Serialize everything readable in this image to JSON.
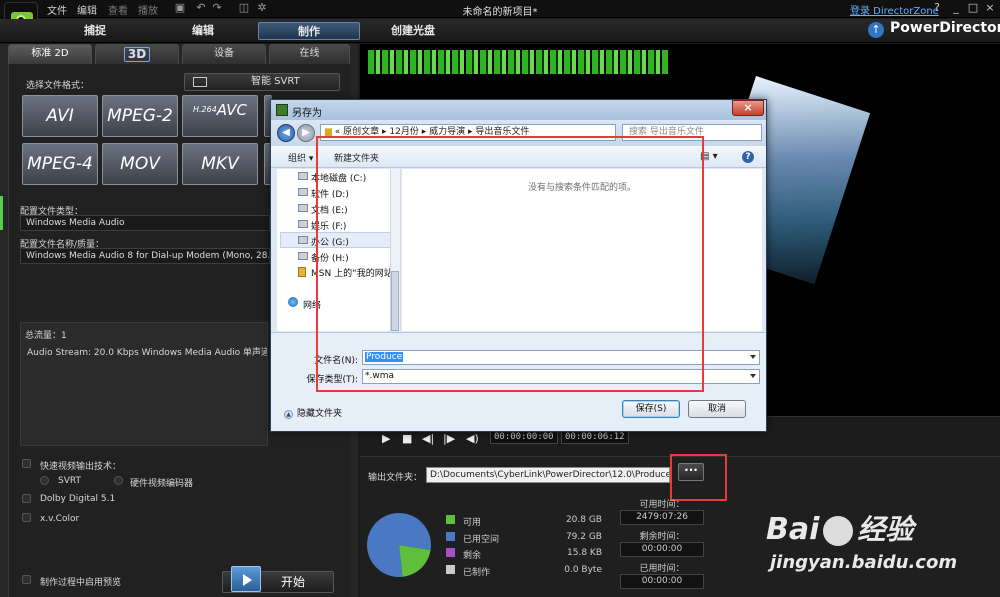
{
  "window": {
    "title": "未命名的新项目*",
    "login_link": "登录 DirectorZone",
    "help_button": "?",
    "minimize": "_",
    "maximize": "□",
    "close": "×"
  },
  "menu": [
    "文件",
    "编辑",
    "查看",
    "播放"
  ],
  "modes": [
    "捕捉",
    "编辑",
    "制作",
    "创建光盘"
  ],
  "brand": "PowerDirector",
  "left_tabs": [
    "标准 2D",
    "3D",
    "设备",
    "在线"
  ],
  "left": {
    "select_format_label": "选择文件格式：",
    "svrt_button": "智能 SVRT",
    "formats": [
      "AVI",
      "MPEG-2",
      "AVC",
      "MPEG-4",
      "MOV",
      "MKV"
    ],
    "h264_sup": "H.264",
    "profile_type_label": "配置文件类型：",
    "profile_type_value": "Windows Media Audio",
    "profile_name_label": "配置文件名称/质量：",
    "profile_name_value": "Windows Media Audio 8 for Dial-up Modem (Mono, 28.8 Kbps)",
    "info_title": "总流量：1",
    "info_text": "Audio Stream:  20.0 Kbps  Windows Media Audio  单声道  22",
    "fast_render_label": "快速视频输出技术：",
    "svrt_option": "SVRT",
    "hw_encoder_option": "硬件视频编码器",
    "dolby_label": "Dolby Digital 5.1",
    "xvcolor_label": "x.v.Color",
    "preview_during_label": "制作过程中启用预览",
    "start_button": "开始"
  },
  "player": {
    "time_current": "00:00:00:00",
    "time_total": "00:00:06:12"
  },
  "output": {
    "label": "输出文件夹：",
    "path": "D:\\Documents\\CyberLink\\PowerDirector\\12.0\\Produce.wma",
    "browse_button": "···",
    "legend": [
      {
        "label": "可用",
        "value": "20.8  GB",
        "color": "#5fbf3c"
      },
      {
        "label": "已用空间",
        "value": "79.2  GB",
        "color": "#4a78c2"
      },
      {
        "label": "剩余",
        "value": "15.8  KB",
        "color": "#a64fc4"
      },
      {
        "label": "已制作",
        "value": "0.0  Byte",
        "color": "#c9c9c9"
      }
    ],
    "available_time_label": "可用时间：",
    "available_time": "2479:07:26",
    "remaining_time_label": "剩余时间：",
    "remaining_time": "00:00:00",
    "used_time_label": "已用时间：",
    "used_time": "00:00:00"
  },
  "disk_chart": {
    "type": "pie",
    "slices": [
      {
        "name": "可用",
        "value": 20.8,
        "color": "#5fbf3c"
      },
      {
        "name": "已用空间",
        "value": 79.2,
        "color": "#4a78c2"
      }
    ]
  },
  "dialog": {
    "title": "另存为",
    "close": "×",
    "breadcrumb": "«  原创文章  ▸  12月份  ▸  威力导演  ▸  导出音乐文件",
    "search_placeholder": "搜索 导出音乐文件",
    "organize": "组织 ▾",
    "new_folder": "新建文件夹",
    "help_icon": "?",
    "tree": [
      "本地磁盘 (C:)",
      "软件 (D:)",
      "文档 (E:)",
      "娱乐 (F:)",
      "办公 (G:)",
      "备份 (H:)",
      "MSN 上的“我的网站”"
    ],
    "network": "网络",
    "empty_message": "没有与搜索条件匹配的项。",
    "filename_label": "文件名(N):",
    "filename_value": "Produce",
    "filetype_label": "保存类型(T):",
    "filetype_value": "*.wma",
    "hide_folders": "隐藏文件夹",
    "save_button": "保存(S)",
    "cancel_button": "取消"
  },
  "watermark": {
    "logo": "Bai",
    "logo_suffix": "经验",
    "url": "jingyan.baidu.com"
  }
}
